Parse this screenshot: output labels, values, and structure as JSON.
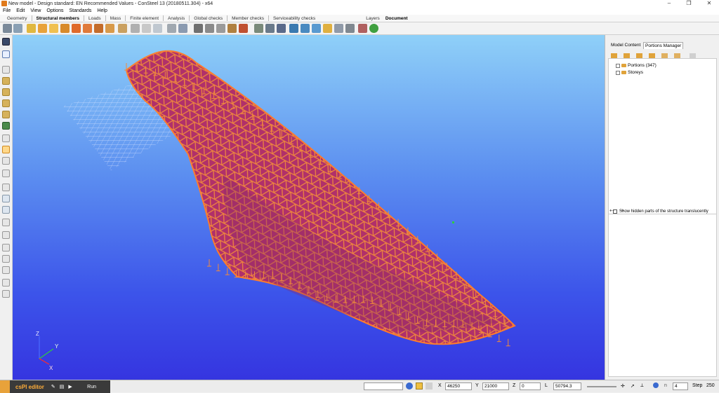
{
  "window": {
    "title": "New model - Design standard: EN Recommended Values - ConSteel 13 (20180511.304) - x64"
  },
  "menu": [
    "File",
    "Edit",
    "View",
    "Options",
    "Standards",
    "Help"
  ],
  "ribbon_tabs": [
    {
      "label": "Geometry",
      "active": false
    },
    {
      "label": "Structural members",
      "active": true
    },
    {
      "label": "Loads",
      "active": false
    },
    {
      "label": "Mass",
      "active": false
    },
    {
      "label": "Finite element",
      "active": false
    },
    {
      "label": "Analysis",
      "active": false
    },
    {
      "label": "Global checks",
      "active": false
    },
    {
      "label": "Member checks",
      "active": false
    },
    {
      "label": "Serviceability checks",
      "active": false
    },
    {
      "label": "Layers",
      "active": false
    },
    {
      "label": "Document",
      "active": true
    }
  ],
  "right_panel": {
    "tabs": [
      "Model Content",
      "Portions Manager"
    ],
    "tree": [
      {
        "label": "Portions (347)"
      },
      {
        "label": "Storeys"
      }
    ],
    "translucent_label": "Show hidden parts of the structure translucently"
  },
  "axes": {
    "z": "Z",
    "y": "Y",
    "x": "X"
  },
  "cspl": {
    "name": "csPl editor",
    "run": "Run"
  },
  "status": {
    "x_label": "X",
    "x_value": "46250",
    "y_label": "Y",
    "y_value": "21000",
    "z_label": "Z",
    "z_value": "0",
    "l_label": "L",
    "l_value": "50794.3",
    "n_value": "4",
    "step_label": "Step",
    "step_value": "250"
  },
  "colors": {
    "accent": "#e8a23a",
    "membrane": "#b0306a",
    "members": "#f08a3c",
    "sky_top": "#8fd0f8",
    "sky_bottom": "#3535e0"
  }
}
